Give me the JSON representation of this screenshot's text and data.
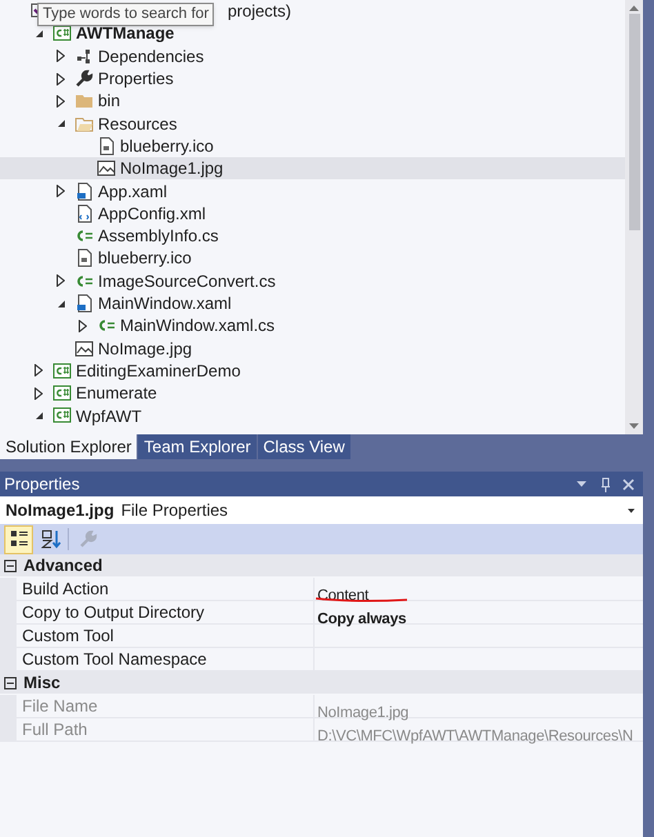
{
  "tooltip": {
    "text": "Type words to search for"
  },
  "tree": [
    {
      "kind": "solution",
      "label": "projects)",
      "selected": false,
      "children": [
        {
          "kind": "project",
          "label": "AWTManage",
          "expanded": true,
          "selected": false,
          "children": [
            {
              "kind": "dependencies",
              "label": "Dependencies",
              "expanded": false,
              "selected": false
            },
            {
              "kind": "properties",
              "label": "Properties",
              "expanded": false,
              "selected": false
            },
            {
              "kind": "folder",
              "label": "bin",
              "expanded": false,
              "selected": false
            },
            {
              "kind": "folder-open",
              "label": "Resources",
              "expanded": true,
              "selected": false,
              "children": [
                {
                  "kind": "ico",
                  "label": "blueberry.ico",
                  "selected": false
                },
                {
                  "kind": "image",
                  "label": "NoImage1.jpg",
                  "selected": true
                }
              ]
            },
            {
              "kind": "xaml",
              "label": "App.xaml",
              "expanded": false,
              "selected": false
            },
            {
              "kind": "xml",
              "label": "AppConfig.xml",
              "selected": false
            },
            {
              "kind": "cs",
              "label": "AssemblyInfo.cs",
              "selected": false
            },
            {
              "kind": "ico",
              "label": "blueberry.ico",
              "selected": false
            },
            {
              "kind": "cs",
              "label": "ImageSourceConvert.cs",
              "expanded": false,
              "selected": false
            },
            {
              "kind": "xaml",
              "label": "MainWindow.xaml",
              "expanded": true,
              "selected": false,
              "children": [
                {
                  "kind": "cs",
                  "label": "MainWindow.xaml.cs",
                  "expanded": false,
                  "selected": false
                }
              ]
            },
            {
              "kind": "image",
              "label": "NoImage.jpg",
              "selected": false
            }
          ]
        },
        {
          "kind": "project",
          "label": "EditingExaminerDemo",
          "expanded": false,
          "selected": false
        },
        {
          "kind": "project",
          "label": "Enumerate",
          "expanded": false,
          "selected": false
        },
        {
          "kind": "project",
          "label": "WpfAWT",
          "expanded": true,
          "selected": false
        }
      ]
    }
  ],
  "tabs": [
    {
      "label": "Solution Explorer",
      "selected": true
    },
    {
      "label": "Team Explorer",
      "selected": false
    },
    {
      "label": "Class View",
      "selected": false
    }
  ],
  "properties": {
    "title": "Properties",
    "object_name": "NoImage1.jpg",
    "object_type": "File Properties",
    "toolbar": [
      {
        "kind": "categorized",
        "selected": true,
        "disabled": false
      },
      {
        "kind": "alphabetical",
        "selected": false,
        "disabled": false
      },
      {
        "kind": "property-pages",
        "selected": false,
        "disabled": true
      }
    ],
    "categories": [
      {
        "name": "Advanced",
        "expanded": true,
        "rows": [
          {
            "name": "Build Action",
            "value": "Content",
            "bold": false,
            "disabled": false,
            "annotated": true
          },
          {
            "name": "Copy to Output Directory",
            "value": "Copy always",
            "bold": true,
            "disabled": false
          },
          {
            "name": "Custom Tool",
            "disabled": false
          },
          {
            "name": "Custom Tool Namespace",
            "disabled": false
          }
        ]
      },
      {
        "name": "Misc",
        "expanded": true,
        "rows": [
          {
            "name": "File Name",
            "value": "NoImage1.jpg",
            "bold": false,
            "disabled": true
          },
          {
            "name": "Full Path",
            "value": "D:\\VC\\MFC\\WpfAWT\\AWTManage\\Resources\\N",
            "bold": false,
            "disabled": true
          }
        ]
      }
    ]
  }
}
